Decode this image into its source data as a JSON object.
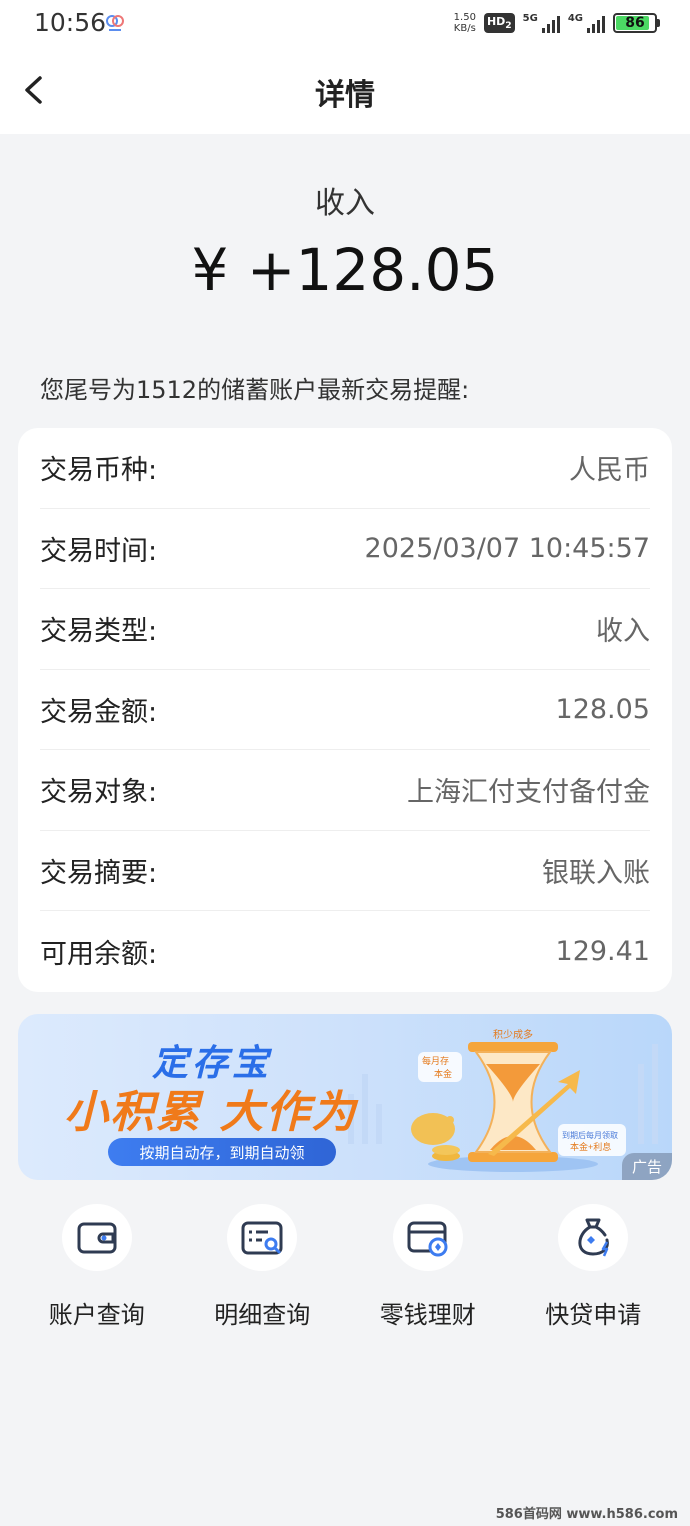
{
  "status_bar": {
    "time": "10:56",
    "net_speed_value": "1.50",
    "net_speed_unit": "KB/s",
    "hd_label": "HD",
    "hd_sub": "2",
    "sig1_label": "5G",
    "sig2_label": "4G",
    "battery": "86",
    "battery_level": 0.86
  },
  "nav": {
    "title": "详情"
  },
  "summary": {
    "type_label": "收入",
    "amount": "¥ +128.05",
    "notice": "您尾号为1512的储蓄账户最新交易提醒:"
  },
  "details": [
    {
      "label": "交易币种:",
      "value": "人民币"
    },
    {
      "label": "交易时间:",
      "value": "2025/03/07 10:45:57"
    },
    {
      "label": "交易类型:",
      "value": "收入"
    },
    {
      "label": "交易金额:",
      "value": "128.05"
    },
    {
      "label": "交易对象:",
      "value": "上海汇付支付备付金"
    },
    {
      "label": "交易摘要:",
      "value": "银联入账"
    },
    {
      "label": "可用余额:",
      "value": "129.41"
    }
  ],
  "ad": {
    "title_small": "定存宝",
    "title_big": "小积累 大作为",
    "pill": "按期自动存，到期自动领",
    "art_tag1": "每月存",
    "art_tag2": "本金",
    "art_top": "积少成多",
    "art_card1": "到期后每月领取",
    "art_card2": "本金+利息",
    "tag": "广告"
  },
  "quick_menu": [
    {
      "label": "账户查询",
      "icon": "wallet-icon"
    },
    {
      "label": "明细查询",
      "icon": "detail-search-icon"
    },
    {
      "label": "零钱理财",
      "icon": "card-coin-icon"
    },
    {
      "label": "快贷申请",
      "icon": "money-bag-icon"
    }
  ],
  "watermark": "586首码网 www.h586.com",
  "colors": {
    "background": "#f3f4f6",
    "card": "#ffffff",
    "ad_blue": "#2a6ee8",
    "ad_orange": "#f07a1a"
  }
}
